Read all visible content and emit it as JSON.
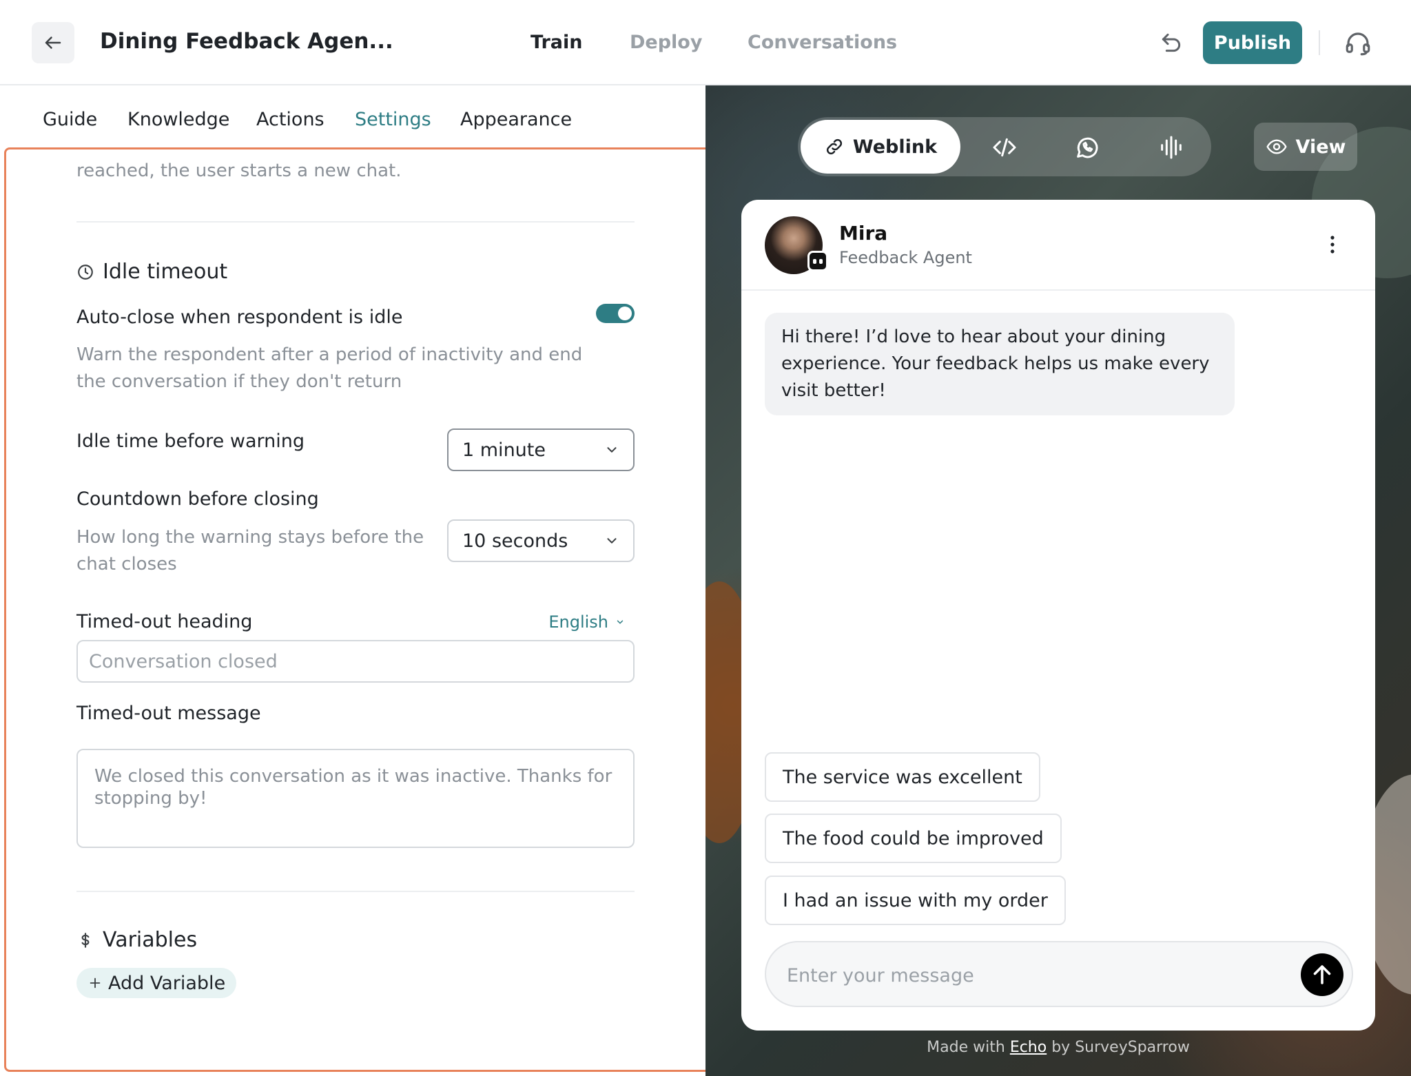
{
  "header": {
    "title": "Dining Feedback Agen...",
    "tabs": [
      "Train",
      "Deploy",
      "Conversations"
    ],
    "active_tab": "Train",
    "publish_label": "Publish"
  },
  "subtabs": {
    "items": [
      "Guide",
      "Knowledge",
      "Actions",
      "Settings",
      "Appearance"
    ],
    "active": "Settings"
  },
  "settings": {
    "prev_note": "reached, the user starts a new chat.",
    "idle": {
      "title": "Idle timeout",
      "auto_close_label": "Auto-close when respondent is idle",
      "auto_close_enabled": true,
      "auto_close_desc_1": "Warn the respondent after a period of inactivity and end",
      "auto_close_desc_2": "the conversation if they don't return",
      "warning_label": "Idle time before warning",
      "warning_value": "1 minute",
      "countdown_label": "Countdown before closing",
      "countdown_desc_1": "How long the warning stays before the",
      "countdown_desc_2": "chat closes",
      "countdown_value": "10 seconds",
      "heading_label": "Timed-out heading",
      "language": "English",
      "heading_placeholder": "Conversation closed",
      "message_label": "Timed-out message",
      "message_placeholder": "We closed this conversation as it was inactive. Thanks for stopping by!"
    },
    "variables": {
      "title": "Variables",
      "add_label": "Add Variable"
    }
  },
  "preview": {
    "channels": {
      "weblink_label": "Weblink",
      "view_label": "View"
    },
    "agent": {
      "name": "Mira",
      "role": "Feedback Agent"
    },
    "greeting": "Hi there! I’d love to hear about your dining experience. Your feedback helps us make every visit better!",
    "quick_replies": [
      "The service was excellent",
      "The food could be improved",
      "I had an issue with my order"
    ],
    "composer_placeholder": "Enter your message",
    "footer": {
      "prefix": "Made with",
      "brand": "Echo",
      "suffix": "by SurveySparrow"
    }
  },
  "colors": {
    "accent": "#2e7d84",
    "highlight_frame": "#e8825a"
  }
}
